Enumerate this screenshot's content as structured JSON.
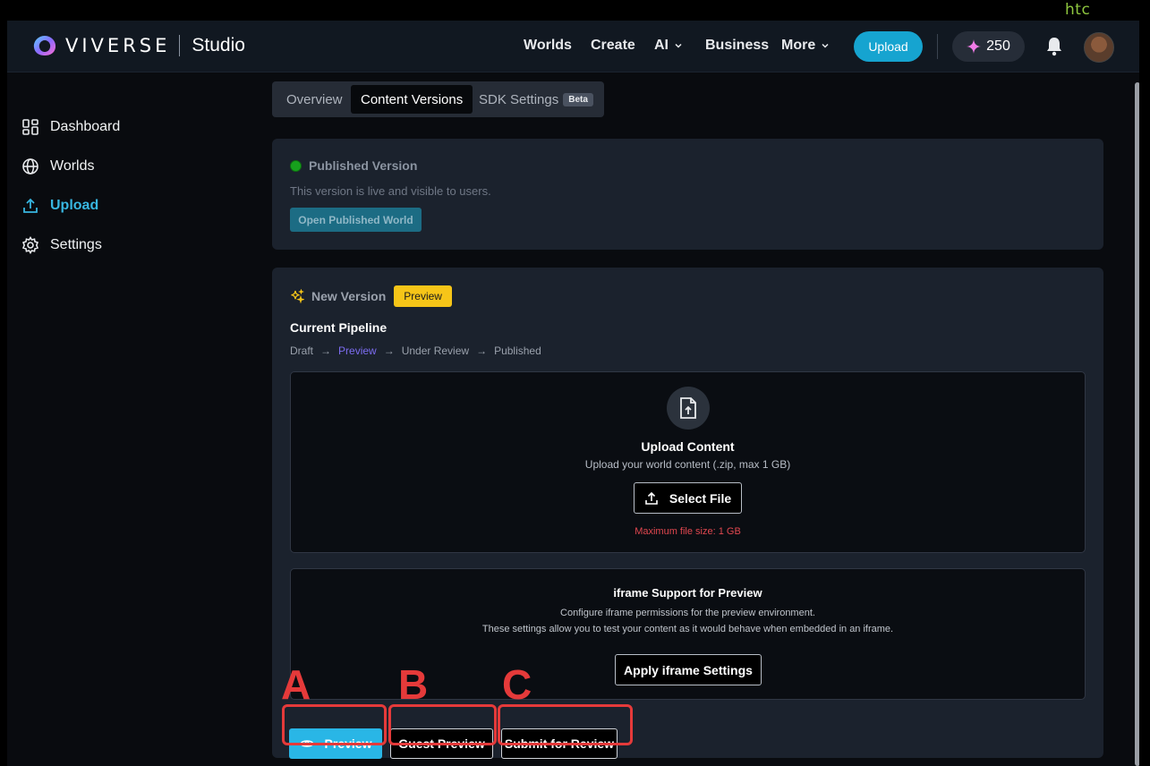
{
  "corner_brand": "htc",
  "header": {
    "logo_text": "VIVERSE",
    "logo_product": "Studio",
    "nav": {
      "worlds": "Worlds",
      "create": "Create",
      "ai": "AI",
      "business": "Business",
      "more": "More"
    },
    "upload_label": "Upload",
    "credits": "250"
  },
  "sidebar": {
    "items": [
      {
        "label": "Dashboard",
        "icon": "dashboard-icon"
      },
      {
        "label": "Worlds",
        "icon": "globe-icon"
      },
      {
        "label": "Upload",
        "icon": "upload-icon",
        "active": true
      },
      {
        "label": "Settings",
        "icon": "gear-icon"
      }
    ]
  },
  "tabs": {
    "overview": "Overview",
    "content_versions": "Content Versions",
    "sdk_settings": "SDK Settings",
    "beta": "Beta"
  },
  "published": {
    "title": "Published Version",
    "description": "This version is live and visible to users.",
    "open_button": "Open Published World",
    "status_color": "#17a01d"
  },
  "new_version": {
    "title": "New Version",
    "badge": "Preview",
    "pipeline_heading": "Current Pipeline",
    "pipeline": {
      "s1": "Draft",
      "s2": "Preview",
      "s3": "Under Review",
      "s4": "Published",
      "arrow": "→"
    },
    "upload": {
      "title": "Upload Content",
      "description": "Upload your world content (.zip, max 1 GB)",
      "button": "Select File",
      "max_size": "Maximum file size: 1 GB"
    },
    "iframe": {
      "title": "iframe Support for Preview",
      "desc1": "Configure iframe permissions for the preview environment.",
      "desc2": "These settings allow you to test your content as it would behave when embedded in an iframe.",
      "button": "Apply iframe Settings"
    },
    "actions": {
      "preview": "Preview",
      "guest_preview": "Guest Preview",
      "submit": "Submit for Review"
    }
  },
  "annotations": {
    "a": "A",
    "b": "B",
    "c": "C"
  },
  "colors": {
    "accent": "#16a4d0",
    "highlight": "#e53a3a",
    "badge": "#f6c518"
  }
}
